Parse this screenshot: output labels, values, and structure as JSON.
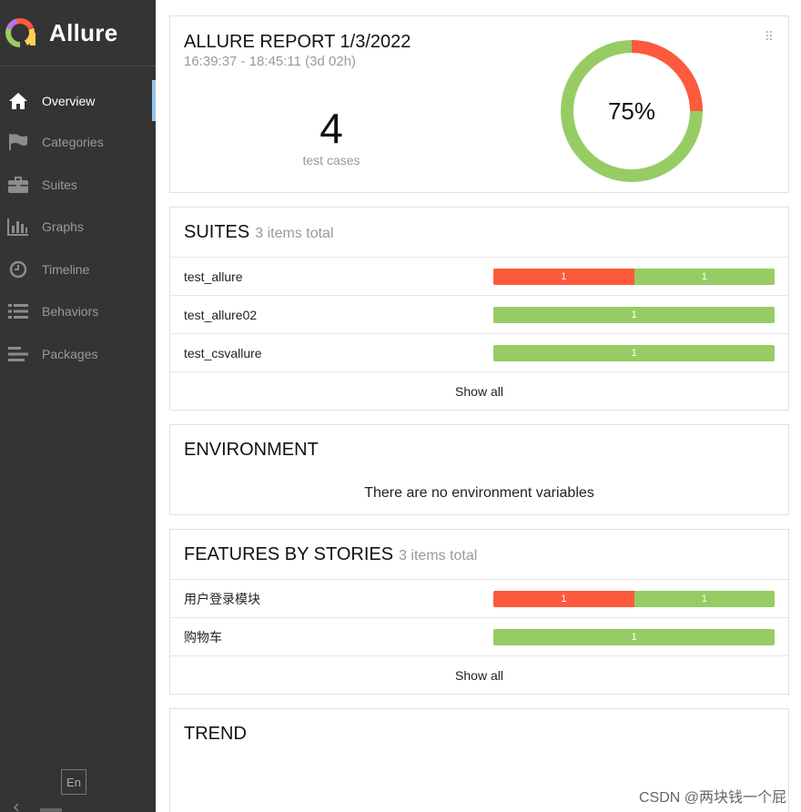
{
  "app": {
    "name": "Allure"
  },
  "sidebar": {
    "items": [
      {
        "label": "Overview",
        "icon": "home-icon",
        "active": true
      },
      {
        "label": "Categories",
        "icon": "flag-icon"
      },
      {
        "label": "Suites",
        "icon": "briefcase-icon"
      },
      {
        "label": "Graphs",
        "icon": "bar-chart-icon"
      },
      {
        "label": "Timeline",
        "icon": "clock-icon"
      },
      {
        "label": "Behaviors",
        "icon": "list-icon"
      },
      {
        "label": "Packages",
        "icon": "align-left-icon"
      }
    ],
    "language": "En"
  },
  "summary": {
    "title": "ALLURE REPORT 1/3/2022",
    "time_range": "16:39:37 - 18:45:11 (3d 02h)",
    "test_count": "4",
    "test_count_label": "test cases",
    "percent_label": "75%",
    "passed_fraction": 0.75,
    "failed_fraction": 0.25
  },
  "suites": {
    "title": "SUITES",
    "subtitle": "3 items total",
    "rows": [
      {
        "name": "test_allure",
        "failed": 1,
        "passed": 1,
        "failed_label": "1",
        "passed_label": "1"
      },
      {
        "name": "test_allure02",
        "failed": 0,
        "passed": 1,
        "passed_label": "1"
      },
      {
        "name": "test_csvallure",
        "failed": 0,
        "passed": 1,
        "passed_label": "1"
      }
    ],
    "show_all": "Show all"
  },
  "environment": {
    "title": "ENVIRONMENT",
    "empty": "There are no environment variables"
  },
  "features": {
    "title": "FEATURES BY STORIES",
    "subtitle": "3 items total",
    "rows": [
      {
        "name": "用户登录模块",
        "failed": 1,
        "passed": 1,
        "failed_label": "1",
        "passed_label": "1"
      },
      {
        "name": "购物车",
        "failed": 0,
        "passed": 1,
        "passed_label": "1"
      }
    ],
    "show_all": "Show all"
  },
  "trend": {
    "title": "TREND"
  },
  "colors": {
    "failed": "#fd5a3e",
    "passed": "#97cc64",
    "sidebar": "#343434",
    "active_marker": "#97c5eb"
  },
  "watermark": "CSDN @两块钱一个屁"
}
